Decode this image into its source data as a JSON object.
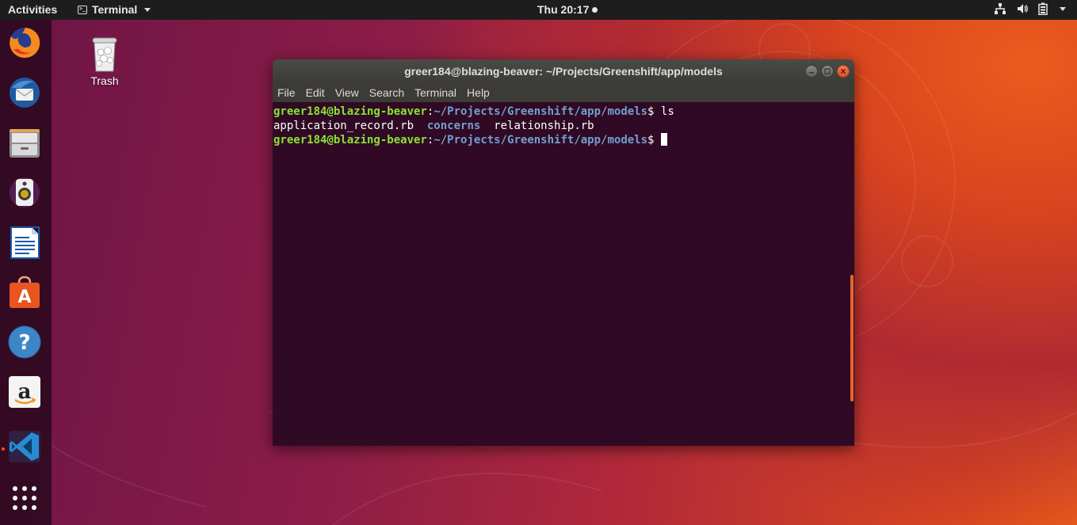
{
  "top_bar": {
    "activities": "Activities",
    "app_menu": "Terminal",
    "clock": "Thu 20:17"
  },
  "dock": {
    "items": [
      "firefox",
      "thunderbird",
      "files",
      "rhythmbox",
      "libreoffice-writer",
      "ubuntu-software",
      "help",
      "amazon",
      "vscode",
      "show-applications"
    ]
  },
  "desktop": {
    "trash_label": "Trash"
  },
  "terminal": {
    "title": "greer184@blazing-beaver: ~/Projects/Greenshift/app/models",
    "menu": [
      "File",
      "Edit",
      "View",
      "Search",
      "Terminal",
      "Help"
    ],
    "prompt_user": "greer184@blazing-beaver",
    "prompt_sep": ":",
    "prompt_path": "~/Projects/Greenshift/app/models",
    "prompt_end": "$ ",
    "command": "ls",
    "ls_output": {
      "file1": "application_record.rb",
      "dir1": "concerns",
      "file2": "relationship.rb"
    }
  },
  "colors": {
    "terminal_bg": "#300a24",
    "prompt_user": "#8ae234",
    "prompt_path": "#729fcf",
    "accent": "#e95420"
  }
}
